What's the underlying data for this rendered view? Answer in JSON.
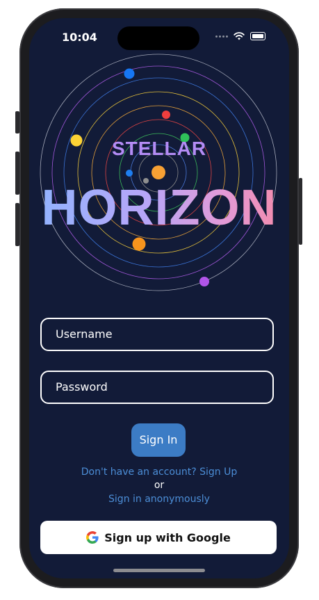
{
  "status_bar": {
    "time": "10:04"
  },
  "logo": {
    "top_text": "STELLAR",
    "main_text": "HORIZON"
  },
  "form": {
    "username_placeholder": "Username",
    "password_placeholder": "Password",
    "sign_in_label": "Sign In"
  },
  "links": {
    "signup": "Don't have an account? Sign Up",
    "or": "or",
    "anonymous": "Sign in anonymously"
  },
  "google_button": {
    "label": "Sign up with Google"
  },
  "icons": [
    "wifi-icon",
    "battery-icon",
    "signal-icon",
    "google-icon"
  ],
  "colors": {
    "background": "#121b38",
    "accent": "#3c7cc5",
    "link": "#4c8ed7",
    "stellar": "#b48cf5"
  }
}
